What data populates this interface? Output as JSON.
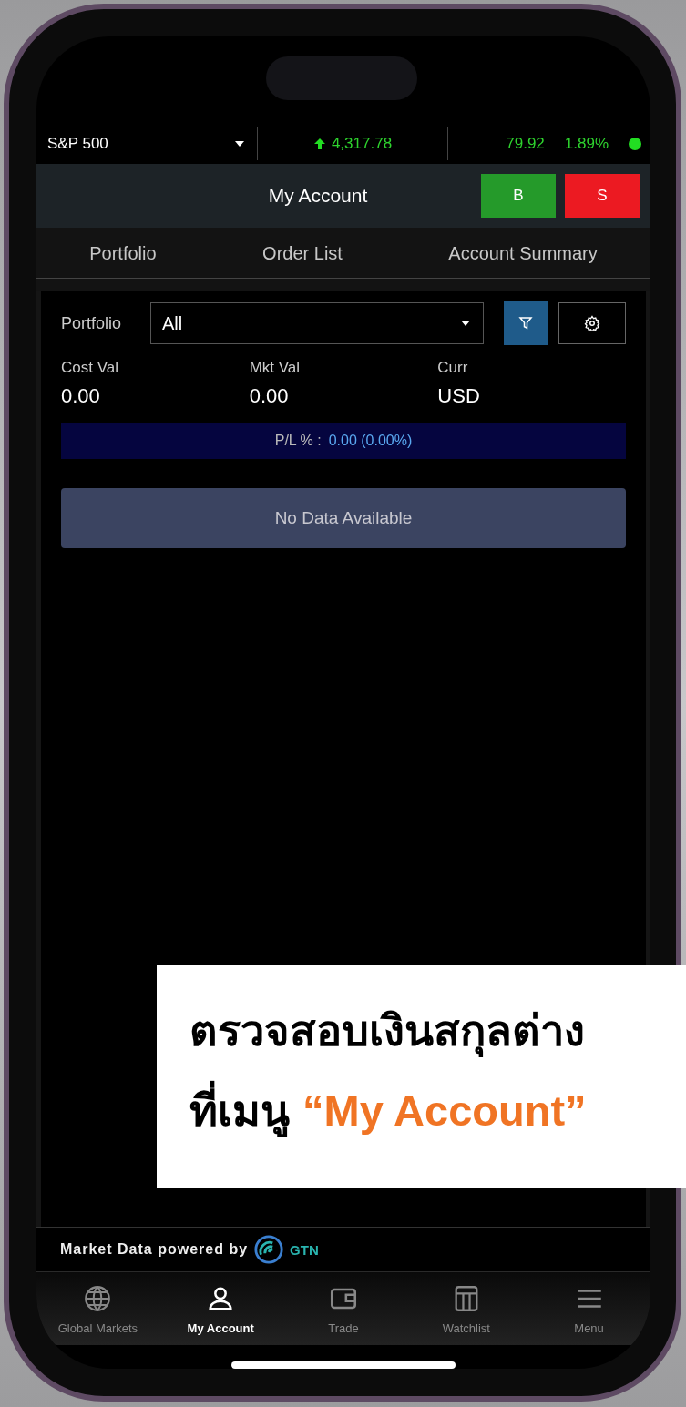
{
  "ticker": {
    "index": "S&P 500",
    "value": "4,317.78",
    "change": "79.92",
    "percent": "1.89%",
    "market_open": true
  },
  "header": {
    "title": "My Account",
    "buy": "B",
    "sell": "S"
  },
  "tabs": [
    {
      "label": "Portfolio"
    },
    {
      "label": "Order List"
    },
    {
      "label": "Account Summary"
    }
  ],
  "portfolio": {
    "label": "Portfolio",
    "value": "All"
  },
  "summary": [
    {
      "label": "Cost Val",
      "value": "0.00"
    },
    {
      "label": "Mkt Val",
      "value": "0.00"
    },
    {
      "label": "Curr",
      "value": "USD"
    }
  ],
  "pl": {
    "label": "P/L % :",
    "value": "0.00 (0.00%)"
  },
  "empty_message": "No Data Available",
  "footer": {
    "text": "Market Data powered by",
    "brand": "GTN"
  },
  "nav": [
    {
      "label": "Global Markets",
      "kind": "globe",
      "selected": false
    },
    {
      "label": "My Account",
      "kind": "person",
      "selected": true
    },
    {
      "label": "Trade",
      "kind": "wallet",
      "selected": false
    },
    {
      "label": "Watchlist",
      "kind": "table",
      "selected": false
    },
    {
      "label": "Menu",
      "kind": "menu",
      "selected": false
    }
  ],
  "caption": {
    "line1": "ตรวจสอบเงินสกุลต่าง",
    "line2": "ที่เมนู",
    "highlight": "“My Account”"
  }
}
